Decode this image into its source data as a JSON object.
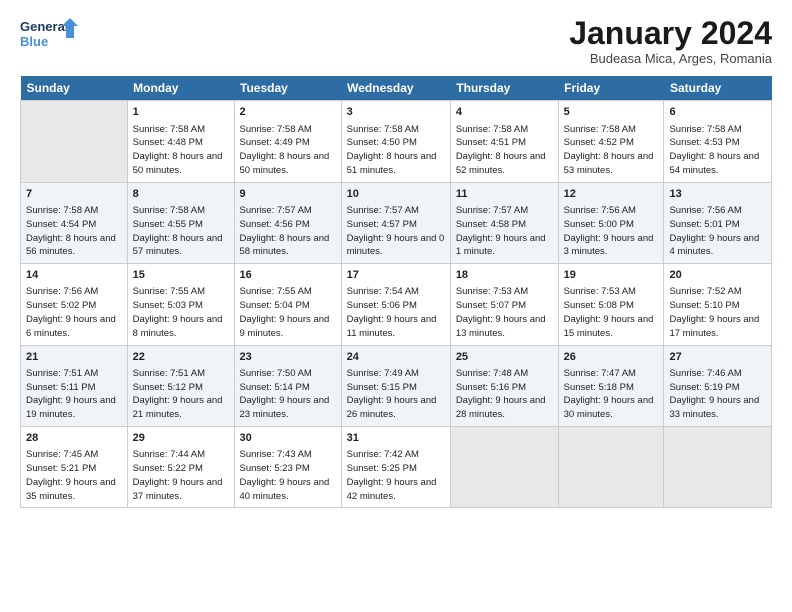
{
  "header": {
    "logo_general": "General",
    "logo_blue": "Blue",
    "month_title": "January 2024",
    "location": "Budeasa Mica, Arges, Romania"
  },
  "weekdays": [
    "Sunday",
    "Monday",
    "Tuesday",
    "Wednesday",
    "Thursday",
    "Friday",
    "Saturday"
  ],
  "weeks": [
    [
      {
        "day": "",
        "empty": true
      },
      {
        "day": "1",
        "sunrise": "7:58 AM",
        "sunset": "4:48 PM",
        "daylight": "8 hours and 50 minutes."
      },
      {
        "day": "2",
        "sunrise": "7:58 AM",
        "sunset": "4:49 PM",
        "daylight": "8 hours and 50 minutes."
      },
      {
        "day": "3",
        "sunrise": "7:58 AM",
        "sunset": "4:50 PM",
        "daylight": "8 hours and 51 minutes."
      },
      {
        "day": "4",
        "sunrise": "7:58 AM",
        "sunset": "4:51 PM",
        "daylight": "8 hours and 52 minutes."
      },
      {
        "day": "5",
        "sunrise": "7:58 AM",
        "sunset": "4:52 PM",
        "daylight": "8 hours and 53 minutes."
      },
      {
        "day": "6",
        "sunrise": "7:58 AM",
        "sunset": "4:53 PM",
        "daylight": "8 hours and 54 minutes."
      }
    ],
    [
      {
        "day": "7",
        "sunrise": "7:58 AM",
        "sunset": "4:54 PM",
        "daylight": "8 hours and 56 minutes."
      },
      {
        "day": "8",
        "sunrise": "7:58 AM",
        "sunset": "4:55 PM",
        "daylight": "8 hours and 57 minutes."
      },
      {
        "day": "9",
        "sunrise": "7:57 AM",
        "sunset": "4:56 PM",
        "daylight": "8 hours and 58 minutes."
      },
      {
        "day": "10",
        "sunrise": "7:57 AM",
        "sunset": "4:57 PM",
        "daylight": "9 hours and 0 minutes."
      },
      {
        "day": "11",
        "sunrise": "7:57 AM",
        "sunset": "4:58 PM",
        "daylight": "9 hours and 1 minute."
      },
      {
        "day": "12",
        "sunrise": "7:56 AM",
        "sunset": "5:00 PM",
        "daylight": "9 hours and 3 minutes."
      },
      {
        "day": "13",
        "sunrise": "7:56 AM",
        "sunset": "5:01 PM",
        "daylight": "9 hours and 4 minutes."
      }
    ],
    [
      {
        "day": "14",
        "sunrise": "7:56 AM",
        "sunset": "5:02 PM",
        "daylight": "9 hours and 6 minutes."
      },
      {
        "day": "15",
        "sunrise": "7:55 AM",
        "sunset": "5:03 PM",
        "daylight": "9 hours and 8 minutes."
      },
      {
        "day": "16",
        "sunrise": "7:55 AM",
        "sunset": "5:04 PM",
        "daylight": "9 hours and 9 minutes."
      },
      {
        "day": "17",
        "sunrise": "7:54 AM",
        "sunset": "5:06 PM",
        "daylight": "9 hours and 11 minutes."
      },
      {
        "day": "18",
        "sunrise": "7:53 AM",
        "sunset": "5:07 PM",
        "daylight": "9 hours and 13 minutes."
      },
      {
        "day": "19",
        "sunrise": "7:53 AM",
        "sunset": "5:08 PM",
        "daylight": "9 hours and 15 minutes."
      },
      {
        "day": "20",
        "sunrise": "7:52 AM",
        "sunset": "5:10 PM",
        "daylight": "9 hours and 17 minutes."
      }
    ],
    [
      {
        "day": "21",
        "sunrise": "7:51 AM",
        "sunset": "5:11 PM",
        "daylight": "9 hours and 19 minutes."
      },
      {
        "day": "22",
        "sunrise": "7:51 AM",
        "sunset": "5:12 PM",
        "daylight": "9 hours and 21 minutes."
      },
      {
        "day": "23",
        "sunrise": "7:50 AM",
        "sunset": "5:14 PM",
        "daylight": "9 hours and 23 minutes."
      },
      {
        "day": "24",
        "sunrise": "7:49 AM",
        "sunset": "5:15 PM",
        "daylight": "9 hours and 26 minutes."
      },
      {
        "day": "25",
        "sunrise": "7:48 AM",
        "sunset": "5:16 PM",
        "daylight": "9 hours and 28 minutes."
      },
      {
        "day": "26",
        "sunrise": "7:47 AM",
        "sunset": "5:18 PM",
        "daylight": "9 hours and 30 minutes."
      },
      {
        "day": "27",
        "sunrise": "7:46 AM",
        "sunset": "5:19 PM",
        "daylight": "9 hours and 33 minutes."
      }
    ],
    [
      {
        "day": "28",
        "sunrise": "7:45 AM",
        "sunset": "5:21 PM",
        "daylight": "9 hours and 35 minutes."
      },
      {
        "day": "29",
        "sunrise": "7:44 AM",
        "sunset": "5:22 PM",
        "daylight": "9 hours and 37 minutes."
      },
      {
        "day": "30",
        "sunrise": "7:43 AM",
        "sunset": "5:23 PM",
        "daylight": "9 hours and 40 minutes."
      },
      {
        "day": "31",
        "sunrise": "7:42 AM",
        "sunset": "5:25 PM",
        "daylight": "9 hours and 42 minutes."
      },
      {
        "day": "",
        "empty": true
      },
      {
        "day": "",
        "empty": true
      },
      {
        "day": "",
        "empty": true
      }
    ]
  ]
}
